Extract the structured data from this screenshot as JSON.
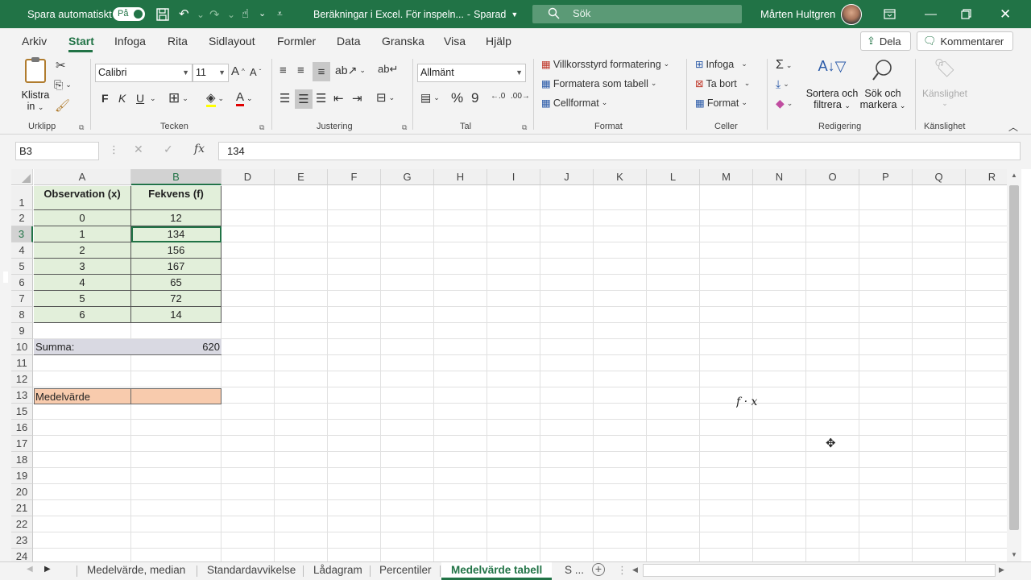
{
  "titlebar": {
    "autosave_label": "Spara automatiskt",
    "autosave_state": "På",
    "file_title": "Beräkningar i Excel. För inspeln...",
    "save_status": "Sparad",
    "search_placeholder": "Sök",
    "user_name": "Mårten Hultgren"
  },
  "menu": {
    "tabs": [
      "Arkiv",
      "Start",
      "Infoga",
      "Rita",
      "Sidlayout",
      "Formler",
      "Data",
      "Granska",
      "Visa",
      "Hjälp"
    ],
    "active_tab": "Start",
    "share_label": "Dela",
    "comments_label": "Kommentarer"
  },
  "ribbon": {
    "clipboard": {
      "paste_label_1": "Klistra",
      "paste_label_2": "in",
      "group": "Urklipp"
    },
    "font": {
      "name": "Calibri",
      "size": "11",
      "bold": "F",
      "italic": "K",
      "underline": "U",
      "group": "Tecken"
    },
    "alignment": {
      "group": "Justering"
    },
    "number": {
      "format": "Allmänt",
      "group": "Tal"
    },
    "styles": {
      "conditional": "Villkorsstyrd formatering",
      "as_table": "Formatera som tabell",
      "cell_styles": "Cellformat",
      "group": "Format"
    },
    "cells": {
      "insert": "Infoga",
      "delete": "Ta bort",
      "format": "Format",
      "group": "Celler"
    },
    "editing": {
      "sort_1": "Sortera och",
      "sort_2": "filtrera",
      "find_1": "Sök och",
      "find_2": "markera",
      "group": "Redigering"
    },
    "sensitivity": {
      "label": "Känslighet",
      "group": "Känslighet"
    }
  },
  "formula_bar": {
    "name_box": "B3",
    "value": "134"
  },
  "grid": {
    "columns": [
      "A",
      "B",
      "D",
      "E",
      "F",
      "G",
      "H",
      "I",
      "J",
      "K",
      "L",
      "M",
      "N",
      "O",
      "P",
      "Q",
      "R"
    ],
    "rows": [
      "1",
      "2",
      "3",
      "4",
      "5",
      "6",
      "7",
      "8",
      "9",
      "10",
      "11",
      "12",
      "13",
      "15",
      "16",
      "17",
      "18",
      "19",
      "20",
      "21",
      "22",
      "23",
      "24"
    ],
    "headers": [
      "Observation (x)",
      "Fekvens (f)"
    ],
    "table_rows": [
      [
        "0",
        "12"
      ],
      [
        "1",
        "134"
      ],
      [
        "2",
        "156"
      ],
      [
        "3",
        "167"
      ],
      [
        "4",
        "65"
      ],
      [
        "5",
        "72"
      ],
      [
        "6",
        "14"
      ]
    ],
    "sum_label": "Summa:",
    "sum_value": "620",
    "mean_label": "Medelvärde",
    "annotation": "f · x"
  },
  "sheet_tabs": [
    "Medelvärde, median",
    "Standardavvikelse",
    "Lådagram",
    "Percentiler",
    "Medelvärde tabell",
    "S ..."
  ],
  "active_sheet": "Medelvärde tabell",
  "colors": {
    "excel_green": "#217346",
    "table_fill": "#e2efda",
    "sum_fill": "#d9d9e2",
    "mean_fill": "#f8cbad"
  }
}
